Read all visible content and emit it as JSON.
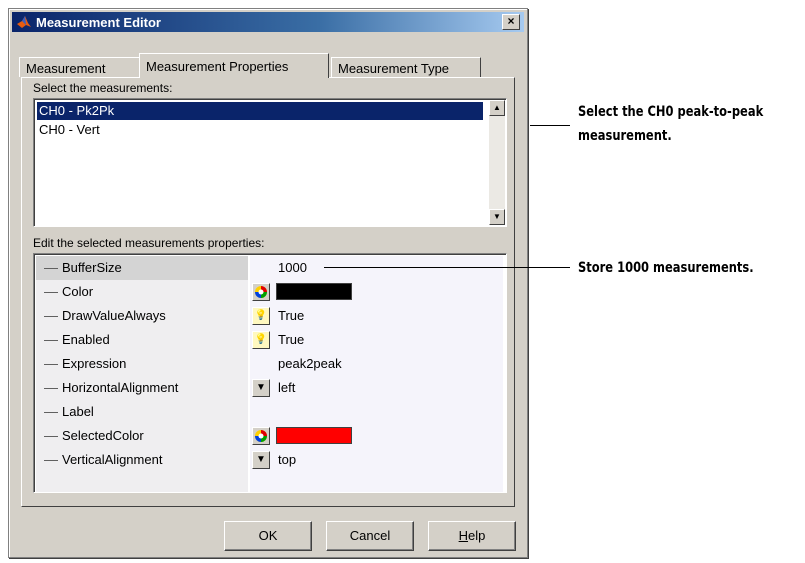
{
  "window": {
    "title": "Measurement Editor",
    "close_label": "×"
  },
  "tabs": [
    {
      "label": "Measurement"
    },
    {
      "label": "Measurement Properties"
    },
    {
      "label": "Measurement Type"
    }
  ],
  "select_section": {
    "label": "Select the measurements:",
    "items": [
      {
        "label": "CH0 - Pk2Pk",
        "selected": true
      },
      {
        "label": "CH0 - Vert",
        "selected": false
      }
    ]
  },
  "properties_section": {
    "label": "Edit the selected measurements properties:",
    "rows": [
      {
        "name": "BufferSize",
        "value": "1000",
        "control": "none"
      },
      {
        "name": "Color",
        "value": "",
        "control": "color-picker-icon",
        "swatch": "#000000"
      },
      {
        "name": "DrawValueAlways",
        "value": "True",
        "control": "lightbulb-icon"
      },
      {
        "name": "Enabled",
        "value": "True",
        "control": "lightbulb-icon"
      },
      {
        "name": "Expression",
        "value": "peak2peak",
        "control": "none"
      },
      {
        "name": "HorizontalAlignment",
        "value": "left",
        "control": "dropdown-arrow-icon"
      },
      {
        "name": "Label",
        "value": "",
        "control": "none"
      },
      {
        "name": "SelectedColor",
        "value": "",
        "control": "color-picker-icon",
        "swatch": "#ff0000"
      },
      {
        "name": "VerticalAlignment",
        "value": "top",
        "control": "dropdown-arrow-icon"
      }
    ]
  },
  "buttons": {
    "ok": "OK",
    "cancel": "Cancel",
    "help_prefix": "H",
    "help_rest": "elp"
  },
  "annotations": [
    {
      "line1": "Select the CH0 peak-to-peak",
      "line2": "measurement."
    },
    {
      "line1": "Store 1000 measurements.",
      "line2": ""
    }
  ],
  "colors": {
    "selection": "#0a246a",
    "dialog_bg": "#d4d0c8"
  }
}
